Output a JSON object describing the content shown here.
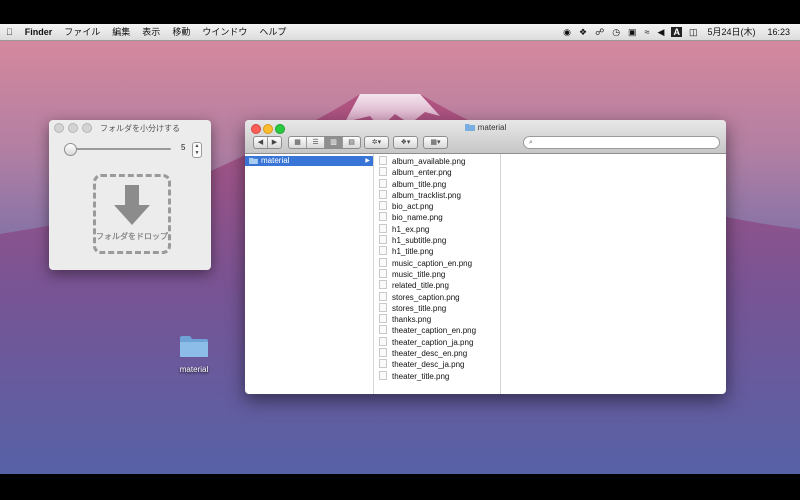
{
  "menubar": {
    "apple": "",
    "app": "Finder",
    "items": [
      "ファイル",
      "編集",
      "表示",
      "移動",
      "ウインドウ",
      "ヘルプ"
    ],
    "status_icons": [
      "cat-icon",
      "dropbox-icon",
      "evernote-icon",
      "time-machine-icon",
      "display-icon",
      "wifi-icon",
      "volume-icon",
      "input-method-icon",
      "battery-icon"
    ],
    "input_method": "A",
    "date": "5月24日(木)",
    "time": "16:23"
  },
  "panel": {
    "title": "フォルダを小分けする",
    "slider_value": 0.02,
    "count": "5",
    "drop_label": "フォルダをドロップ"
  },
  "desktop": {
    "folder_label": "material"
  },
  "finder": {
    "title": "material",
    "sidebar_selected": "material",
    "files": [
      "album_available.png",
      "album_enter.png",
      "album_title.png",
      "album_tracklist.png",
      "bio_act.png",
      "bio_name.png",
      "h1_ex.png",
      "h1_subtitle.png",
      "h1_title.png",
      "music_caption_en.png",
      "music_title.png",
      "related_title.png",
      "stores_caption.png",
      "stores_title.png",
      "thanks.png",
      "theater_caption_en.png",
      "theater_caption_ja.png",
      "theater_desc_en.png",
      "theater_desc_ja.png",
      "theater_title.png"
    ],
    "search_placeholder": ""
  },
  "colors": {
    "selection": "#3875d7",
    "close": "#fc5f57",
    "minimize": "#fdbc2e",
    "maximize": "#29c940"
  }
}
